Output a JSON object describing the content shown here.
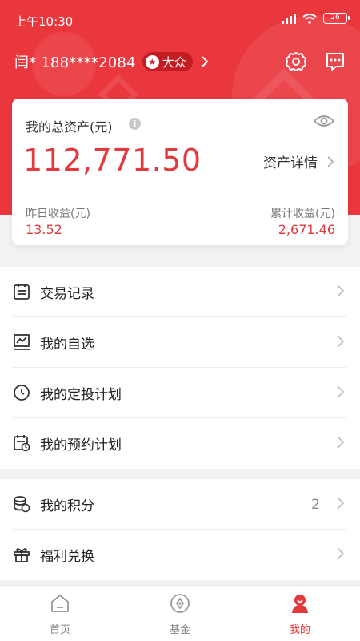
{
  "status_bar": {
    "time": "上午10:30",
    "battery": "26"
  },
  "header": {
    "user_name": "闫* 188****2084",
    "level_badge": "大众",
    "icons": [
      "gear-icon",
      "message-icon"
    ]
  },
  "asset_card": {
    "label": "我的总资产(元)",
    "amount": "112,771.50",
    "detail_label": "资产详情",
    "yesterday_label": "昨日收益(元)",
    "yesterday_value": "13.52",
    "total_label": "累计收益(元)",
    "total_value": "2,671.46"
  },
  "menu_group_1": [
    {
      "label": "交易记录",
      "icon": "document-list-icon"
    },
    {
      "label": "我的自选",
      "icon": "chart-icon"
    },
    {
      "label": "我的定投计划",
      "icon": "clock-icon"
    },
    {
      "label": "我的预约计划",
      "icon": "calendar-icon"
    }
  ],
  "menu_group_2": [
    {
      "label": "我的积分",
      "value": "2",
      "icon": "coins-icon"
    },
    {
      "label": "福利兑换",
      "icon": "gift-icon"
    }
  ],
  "tabs": [
    {
      "label": "首页",
      "icon": "home-icon",
      "active": false
    },
    {
      "label": "基金",
      "icon": "fund-icon",
      "active": false
    },
    {
      "label": "我的",
      "icon": "profile-icon",
      "active": true
    }
  ],
  "colors": {
    "accent": "#e9373d",
    "amount": "#e23b3f"
  }
}
